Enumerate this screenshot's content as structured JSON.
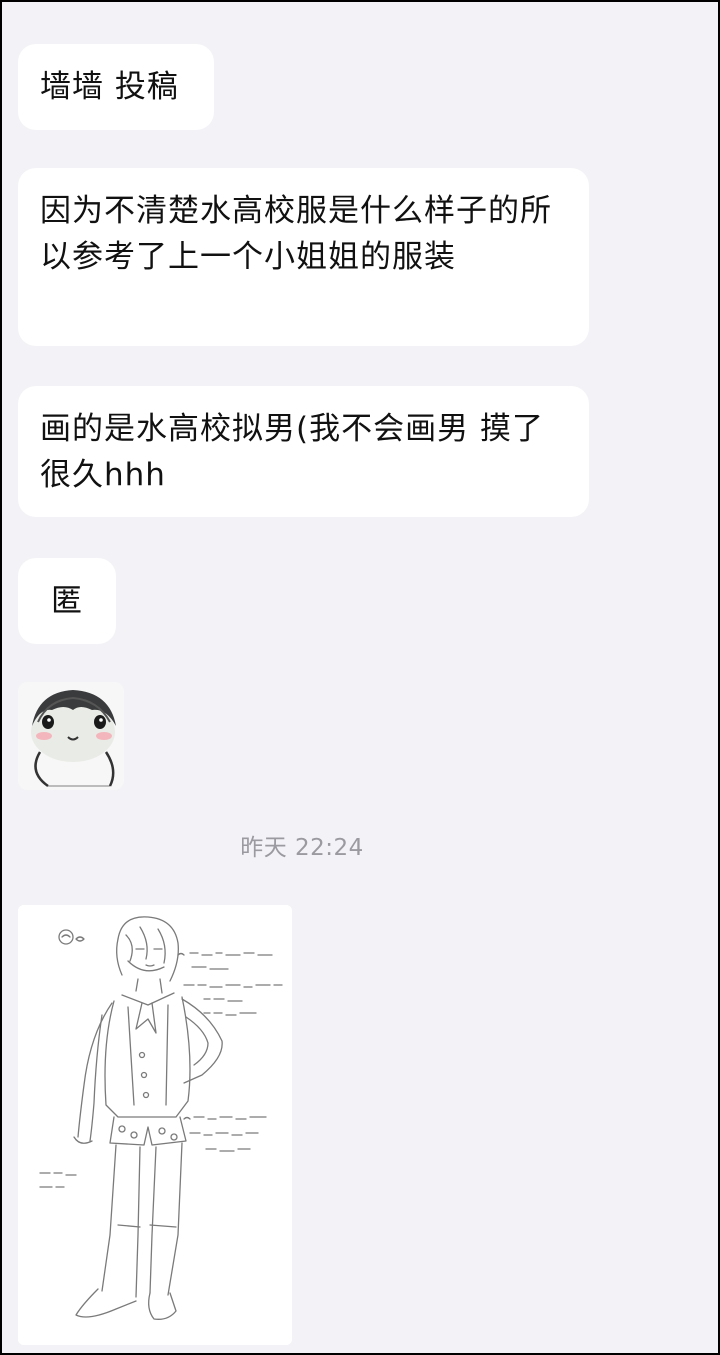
{
  "messages": [
    {
      "text": "墙墙 投稿"
    },
    {
      "text": "因为不清楚水高校服是什么样子的所以参考了上一个小姐姐的服装"
    },
    {
      "text": "画的是水高校拟男(我不会画男 摸了很久hhh"
    },
    {
      "text": "匿"
    }
  ],
  "timestamp": "昨天 22:24",
  "sticker": {
    "icon": "penguin-sticker-icon"
  },
  "drawing": {
    "icon": "sketch-drawing-image"
  }
}
